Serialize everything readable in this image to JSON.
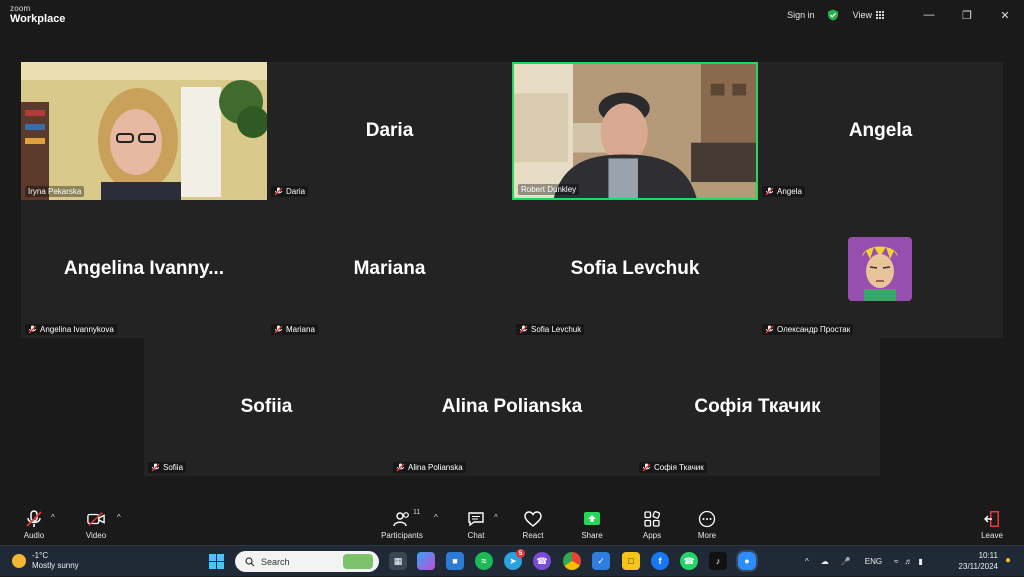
{
  "app": {
    "brand_small": "zoom",
    "brand_large": "Workplace"
  },
  "titlebar": {
    "signin": "Sign in",
    "view": "View",
    "icons": [
      "shield-check-icon",
      "minimize-icon",
      "restore-icon",
      "close-icon"
    ]
  },
  "participants": [
    {
      "display": "",
      "label": "Iryna Pekarska",
      "video": true
    },
    {
      "display": "Daria",
      "label": "Daria",
      "video": false
    },
    {
      "display": "",
      "label": "Robert Dunkley",
      "video": true,
      "active": true
    },
    {
      "display": "Angela",
      "label": "Angela",
      "video": false
    },
    {
      "display": "Angelina  Ivanny...",
      "label": "Angelina Ivannykova",
      "video": false
    },
    {
      "display": "Mariana",
      "label": "Mariana",
      "video": false
    },
    {
      "display": "Sofia Levchuk",
      "label": "Sofia Levchuk",
      "video": false
    },
    {
      "display": "",
      "label": "Олександр Простак",
      "video": false,
      "avatar": true
    },
    {
      "display": "Sofiia",
      "label": "Sofiia",
      "video": false
    },
    {
      "display": "Alina Polianska",
      "label": "Alina Polianska",
      "video": false
    },
    {
      "display": "Софія Ткачик",
      "label": "Софія Ткачик",
      "video": false
    }
  ],
  "toolbar": {
    "audio": "Audio",
    "video": "Video",
    "participants": "Participants",
    "participants_count": "11",
    "chat": "Chat",
    "react": "React",
    "share": "Share",
    "apps": "Apps",
    "more": "More",
    "leave": "Leave"
  },
  "taskbar": {
    "temp": "-1°C",
    "weather": "Mostly sunny",
    "search_placeholder": "Search",
    "lang": "ENG",
    "time": "10:11",
    "date": "23/11/2024",
    "telegram_badge": "5"
  },
  "colors": {
    "active_border": "#23d95a",
    "share_green": "#23d95a",
    "leave_red": "#e03a3a"
  }
}
